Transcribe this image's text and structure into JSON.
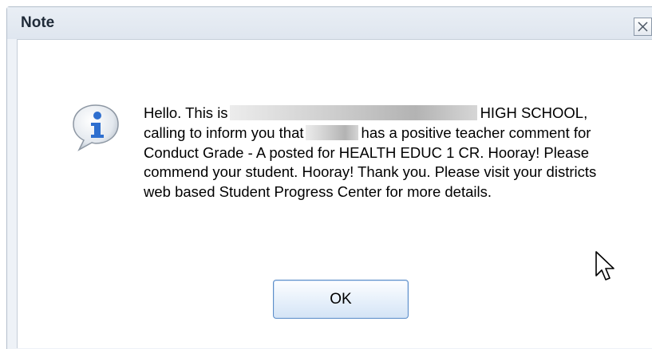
{
  "dialog": {
    "title": "Note",
    "close_icon": "close-icon",
    "info_icon": "info-icon",
    "message": {
      "part1": "Hello. This is",
      "part2": "HIGH SCHOOL, calling to inform you that",
      "part3": "has a positive teacher comment for Conduct Grade - A posted for HEALTH EDUC 1 CR. Hooray! Please commend your student. Hooray! Thank you. Please visit your districts web based Student Progress Center for more details."
    },
    "ok_label": "OK"
  },
  "colors": {
    "accent": "#5c8ec9",
    "icon_blue": "#2f6fcf"
  }
}
